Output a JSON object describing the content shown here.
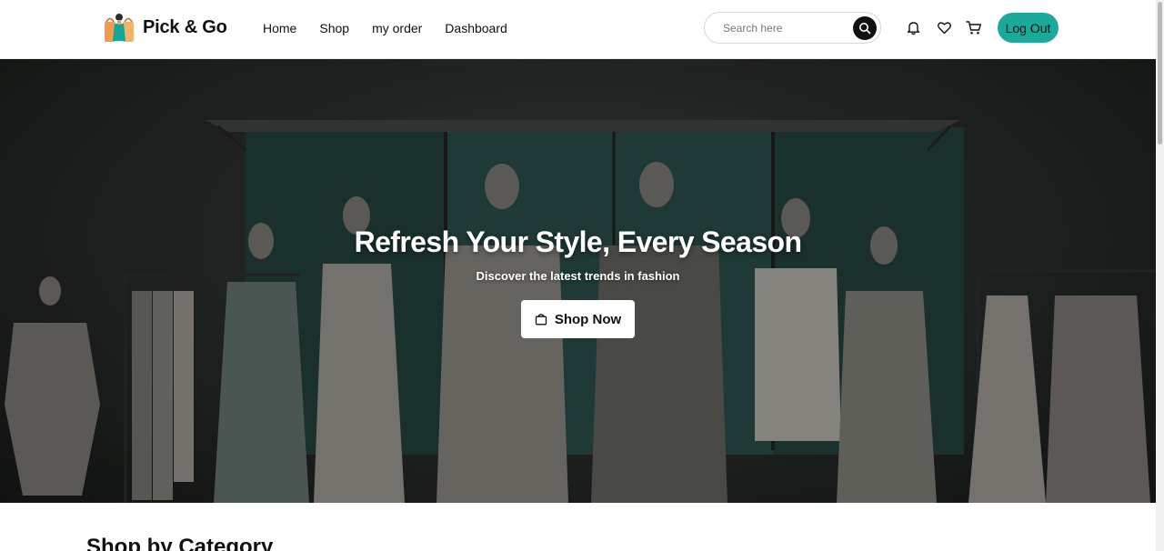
{
  "header": {
    "brand": "Pick & Go",
    "nav": [
      {
        "label": "Home"
      },
      {
        "label": "Shop"
      },
      {
        "label": "my order"
      },
      {
        "label": "Dashboard"
      }
    ],
    "search": {
      "placeholder": "Search here",
      "value": ""
    },
    "icons": [
      "search-icon",
      "bell-icon",
      "heart-icon",
      "cart-icon"
    ],
    "logout_label": "Log Out"
  },
  "hero": {
    "title": "Refresh Your Style, Every Season",
    "subtitle": "Discover the latest trends in fashion",
    "cta_label": "Shop Now",
    "cta_icon": "shopping-bag-icon"
  },
  "sections": {
    "category_title": "Shop by Category"
  },
  "colors": {
    "accent": "#1aa99a",
    "hero_backdrop": "#1f3b38",
    "text": "#111111"
  }
}
